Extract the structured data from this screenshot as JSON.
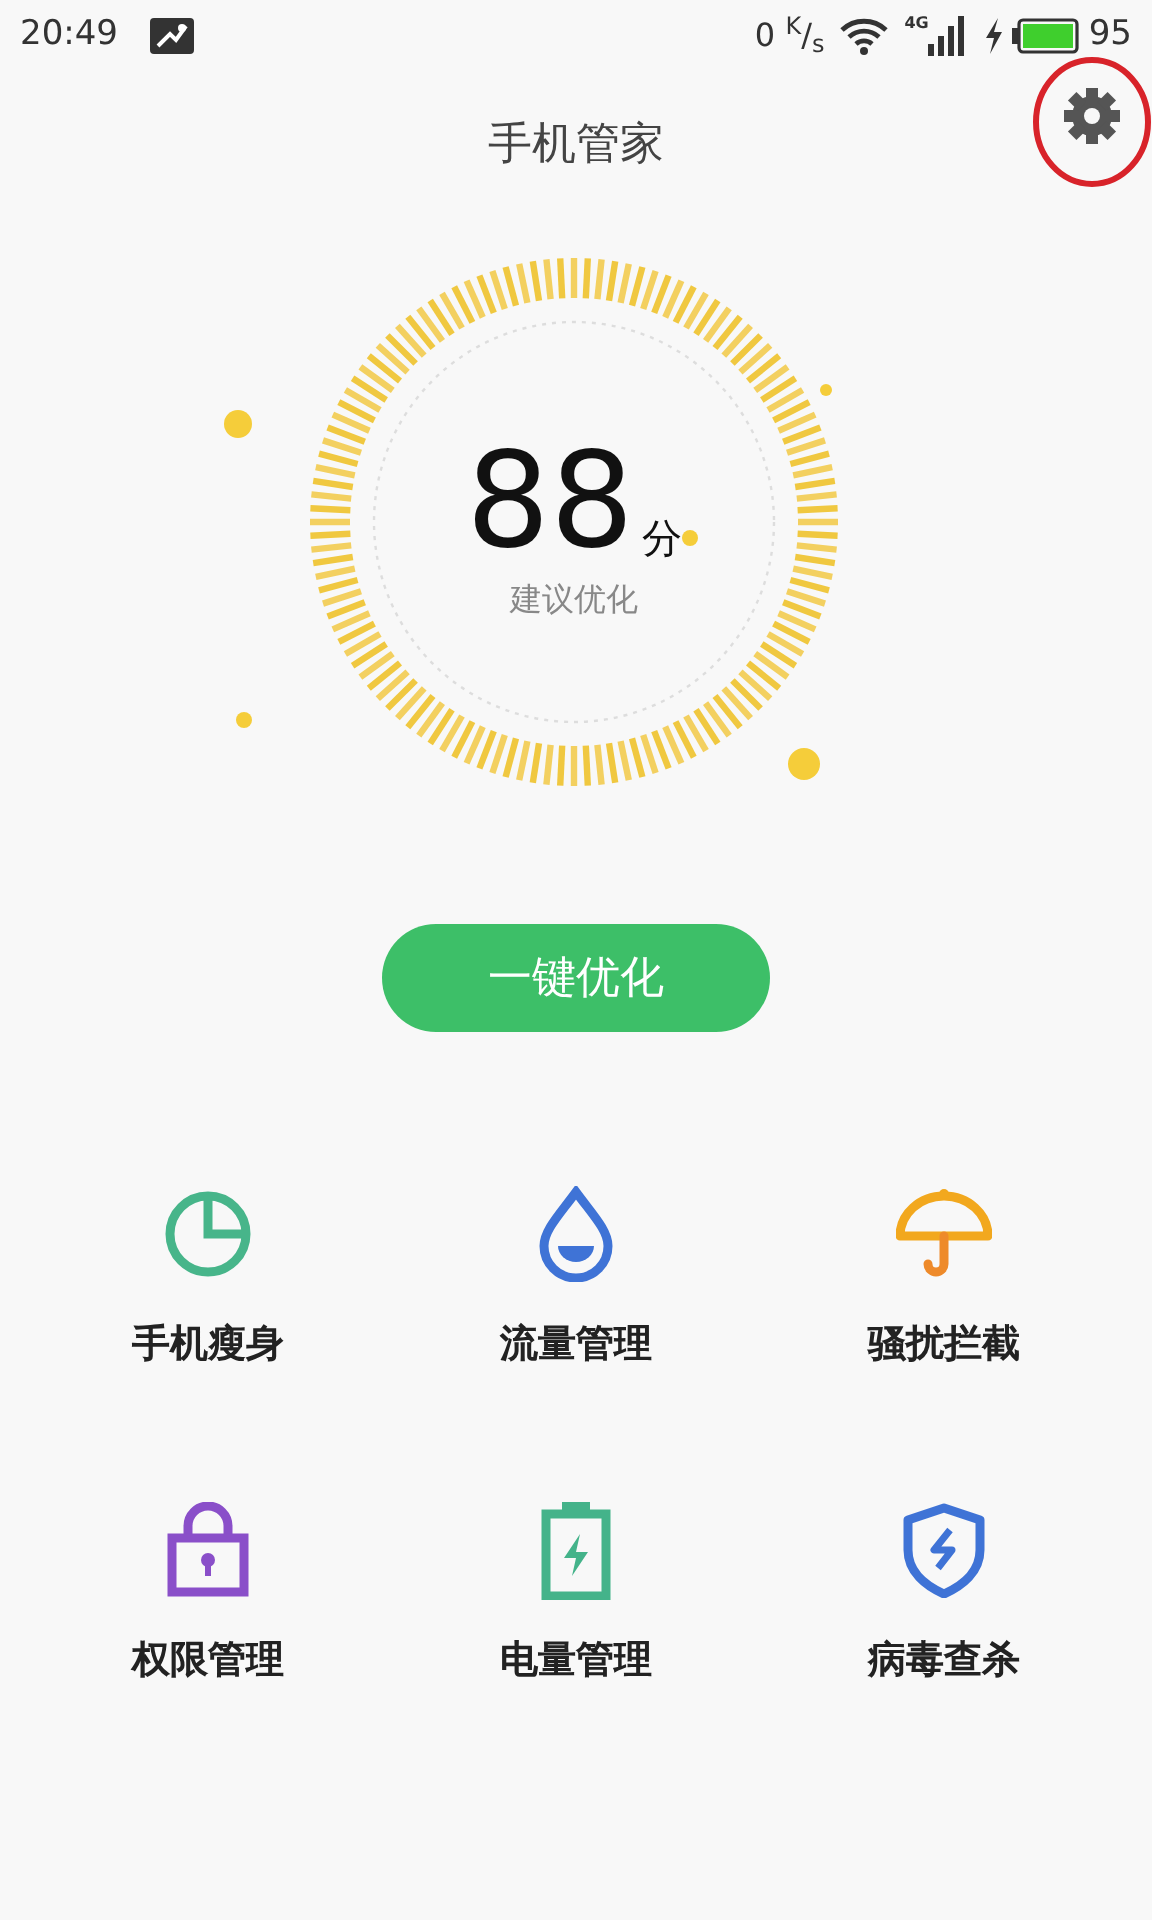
{
  "status_bar": {
    "time": "20:49",
    "speed": "0 $^{K}$/$_{s}$",
    "network": "4G",
    "battery": "95"
  },
  "header": {
    "title": "手机管家"
  },
  "score": {
    "value": "88",
    "unit": "分",
    "advice": "建议优化"
  },
  "optimize_button": {
    "label": "一键优化"
  },
  "tools": [
    {
      "kind": "pie",
      "label": "手机瘦身"
    },
    {
      "kind": "drop",
      "label": "流量管理"
    },
    {
      "kind": "umbrella",
      "label": "骚扰拦截"
    },
    {
      "kind": "lock",
      "label": "权限管理"
    },
    {
      "kind": "battery",
      "label": "电量管理"
    },
    {
      "kind": "shield",
      "label": "病毒查杀"
    }
  ]
}
